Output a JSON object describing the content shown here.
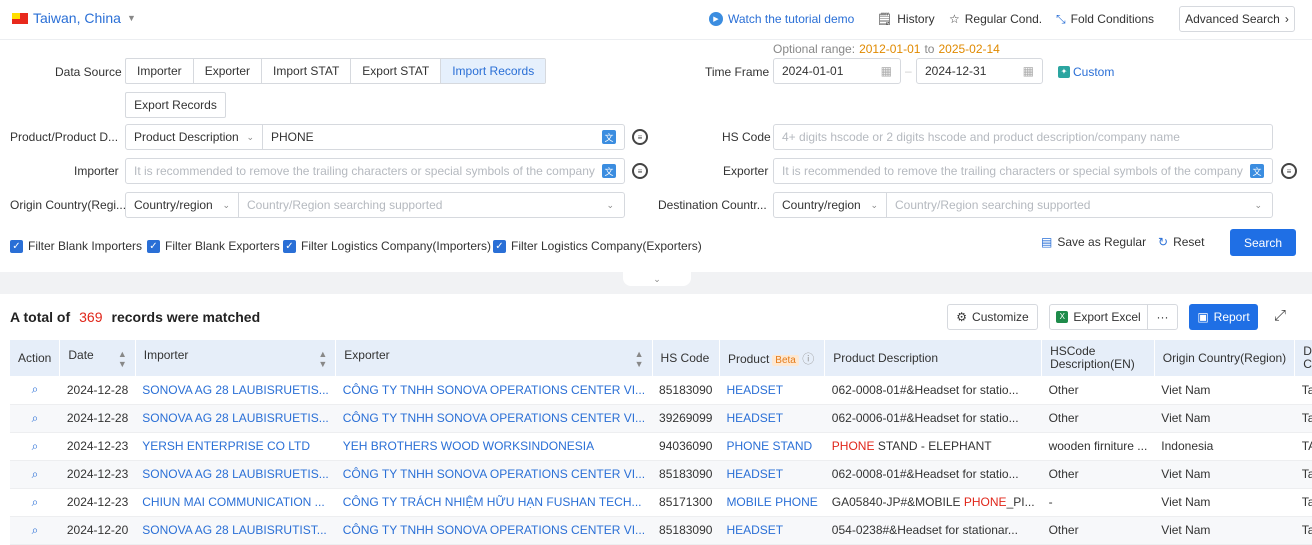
{
  "topbar": {
    "region": "Taiwan, China",
    "tutorial": "Watch the tutorial demo",
    "history": "History",
    "regular_cond": "Regular Cond.",
    "fold_conditions": "Fold Conditions",
    "advanced_search": "Advanced Search"
  },
  "range": {
    "label": "Optional range:",
    "start": "2012-01-01",
    "to": "to",
    "end": "2025-02-14"
  },
  "form": {
    "data_source_label": "Data Source",
    "data_source_options": [
      "Importer",
      "Exporter",
      "Import STAT",
      "Export STAT",
      "Import Records"
    ],
    "data_source_extra": "Export Records",
    "time_frame_label": "Time Frame",
    "date_from": "2024-01-01",
    "date_to": "2024-12-31",
    "date_sep": "–",
    "custom_label": "Custom",
    "product_label": "Product/Product D...",
    "product_type": "Product Description",
    "product_value": "PHONE",
    "hs_code_label": "HS Code",
    "hs_code_placeholder": "4+ digits hscode or 2 digits hscode and product description/company name",
    "importer_label": "Importer",
    "importer_placeholder": "It is recommended to remove the trailing characters or special symbols of the company",
    "exporter_label": "Exporter",
    "exporter_placeholder": "It is recommended to remove the trailing characters or special symbols of the company",
    "origin_label": "Origin Country(Regi...",
    "origin_type": "Country/region",
    "origin_placeholder": "Country/Region searching supported",
    "dest_label": "Destination Countr...",
    "dest_type": "Country/region",
    "dest_placeholder": "Country/Region searching supported"
  },
  "filters": [
    "Filter Blank Importers",
    "Filter Blank Exporters",
    "Filter Logistics Company(Importers)",
    "Filter Logistics Company(Exporters)"
  ],
  "actions": {
    "save_regular": "Save as Regular",
    "reset": "Reset",
    "search": "Search"
  },
  "results": {
    "prefix": "A total of",
    "count": "369",
    "suffix": "records were matched",
    "customize": "Customize",
    "export_excel": "Export Excel",
    "more": "···",
    "report": "Report"
  },
  "table": {
    "headers": {
      "action": "Action",
      "date": "Date",
      "importer": "Importer",
      "exporter": "Exporter",
      "hs_code": "HS Code",
      "product": "Product",
      "beta": "Beta",
      "product_desc": "Product Description",
      "hs_desc_1": "HSCode",
      "hs_desc_2": "Description(EN)",
      "origin": "Origin Country(Region)",
      "dest_1": "De",
      "dest_2": "Co"
    },
    "rows": [
      {
        "date": "2024-12-28",
        "importer": "SONOVA AG 28 LAUBISRUETIS...",
        "exporter": "CÔNG TY TNHH SONOVA OPERATIONS CENTER VI...",
        "hs": "85183090",
        "product": "HEADSET",
        "desc_pre": "",
        "desc_hl": "",
        "desc_post": "062-0008-01#&Headset for statio...",
        "hs_desc": "Other",
        "origin": "Viet Nam",
        "dest": "Ta"
      },
      {
        "date": "2024-12-28",
        "importer": "SONOVA AG 28 LAUBISRUETIS...",
        "exporter": "CÔNG TY TNHH SONOVA OPERATIONS CENTER VI...",
        "hs": "39269099",
        "product": "HEADSET",
        "desc_pre": "",
        "desc_hl": "",
        "desc_post": "062-0006-01#&Headset for statio...",
        "hs_desc": "Other",
        "origin": "Viet Nam",
        "dest": "Ta"
      },
      {
        "date": "2024-12-23",
        "importer": "YERSH ENTERPRISE CO LTD",
        "exporter": "YEH BROTHERS WOOD WORKSINDONESIA",
        "hs": "94036090",
        "product": "PHONE STAND",
        "desc_pre": "",
        "desc_hl": "PHONE",
        "desc_post": " STAND - ELEPHANT",
        "hs_desc": "wooden firniture ...",
        "origin": "Indonesia",
        "dest": "TA"
      },
      {
        "date": "2024-12-23",
        "importer": "SONOVA AG 28 LAUBISRUETIS...",
        "exporter": "CÔNG TY TNHH SONOVA OPERATIONS CENTER VI...",
        "hs": "85183090",
        "product": "HEADSET",
        "desc_pre": "",
        "desc_hl": "",
        "desc_post": "062-0008-01#&Headset for statio...",
        "hs_desc": "Other",
        "origin": "Viet Nam",
        "dest": "Ta"
      },
      {
        "date": "2024-12-23",
        "importer": "CHIUN MAI COMMUNICATION ...",
        "exporter": "CÔNG TY TRÁCH NHIỆM HỮU HẠN FUSHAN TECH...",
        "hs": "85171300",
        "product": "MOBILE PHONE",
        "desc_pre": "GA05840-JP#&MOBILE ",
        "desc_hl": "PHONE",
        "desc_post": "_PI...",
        "hs_desc": "-",
        "origin": "Viet Nam",
        "dest": "Ta"
      },
      {
        "date": "2024-12-20",
        "importer": "SONOVA AG 28 LAUBISRUTIST...",
        "exporter": "CÔNG TY TNHH SONOVA OPERATIONS CENTER VI...",
        "hs": "85183090",
        "product": "HEADSET",
        "desc_pre": "",
        "desc_hl": "",
        "desc_post": "054-0238#&Headset for stationar...",
        "hs_desc": "Other",
        "origin": "Viet Nam",
        "dest": "Ta"
      }
    ]
  },
  "colors": {
    "accent": "#2a6fd6",
    "highlight": "#e0261a",
    "range": "#e08a00",
    "header_bg": "#e6eef9"
  },
  "icons": [
    "search-icon",
    "history-icon",
    "star-icon",
    "fold-icon",
    "calendar-icon",
    "chevron-down-icon",
    "sort-icon",
    "info-icon",
    "expand-icon",
    "excel-icon",
    "report-icon",
    "customize-icon",
    "save-icon",
    "reset-icon"
  ]
}
